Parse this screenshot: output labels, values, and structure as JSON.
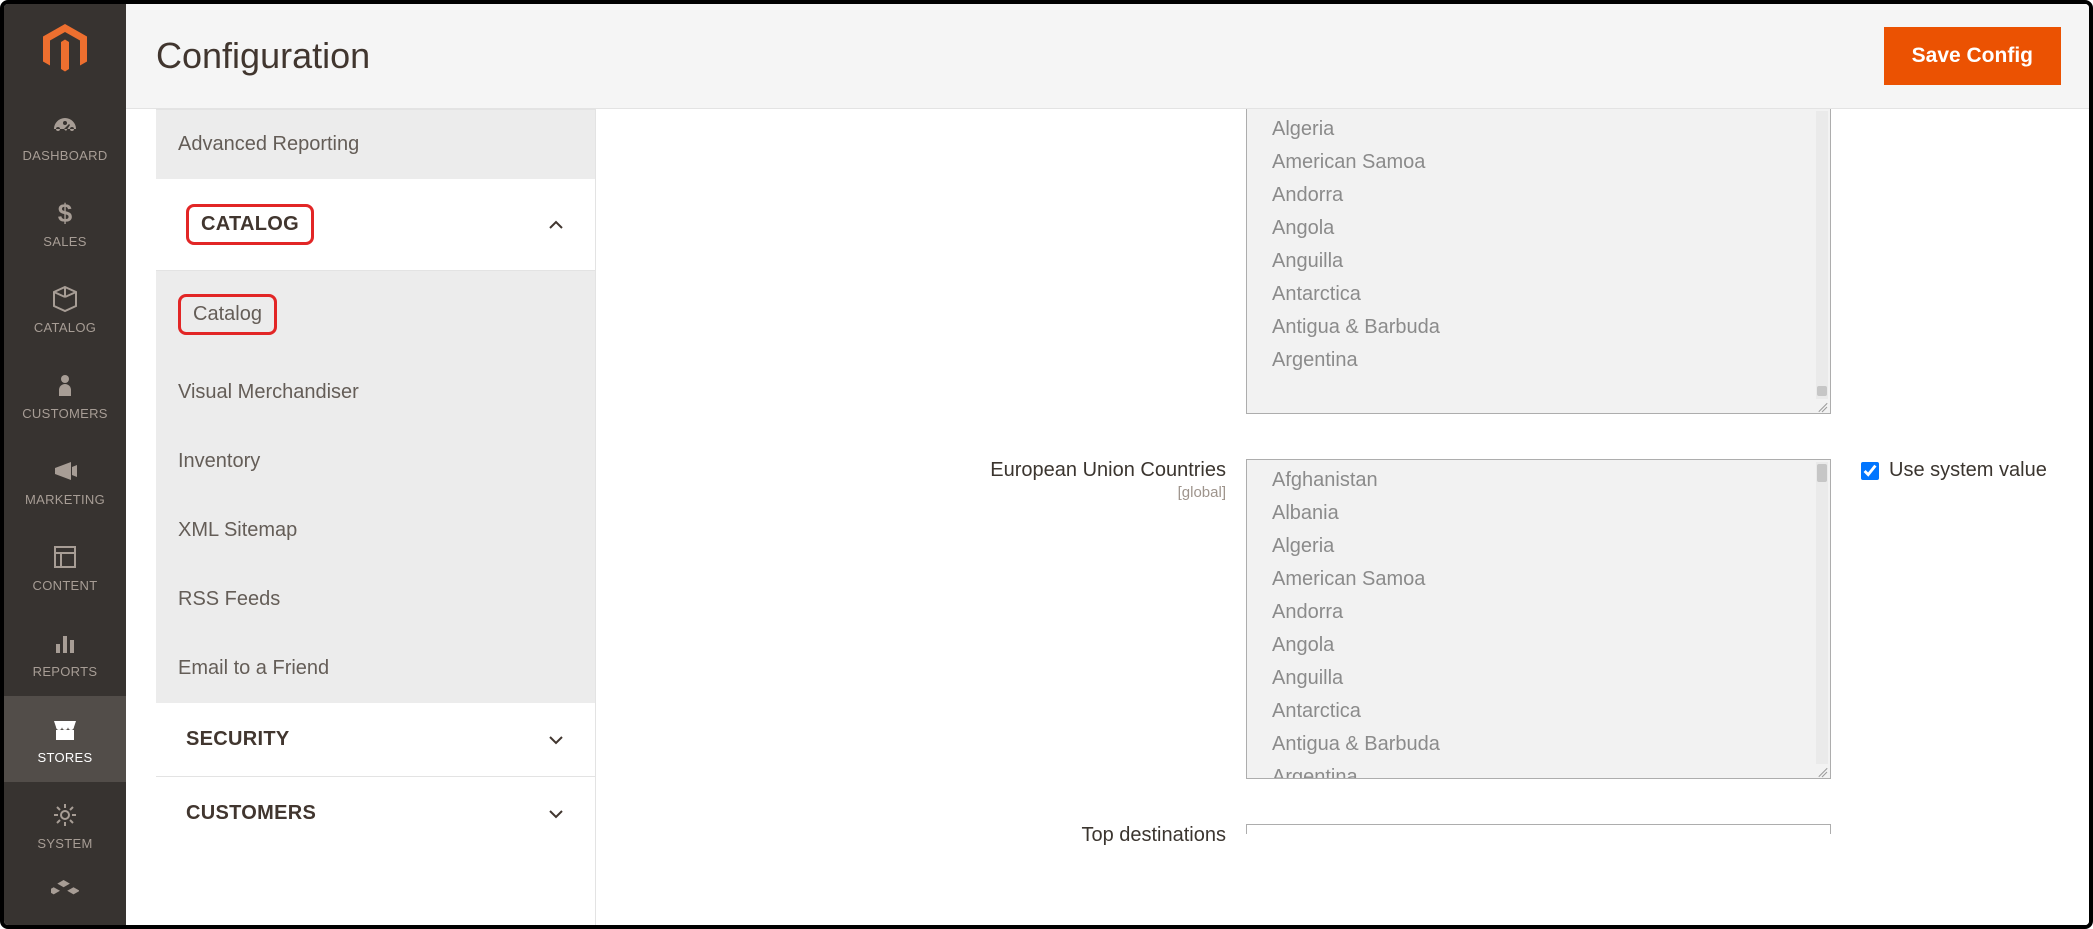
{
  "page": {
    "title": "Configuration",
    "save_button": "Save Config"
  },
  "leftnav": {
    "items": [
      {
        "key": "dashboard",
        "label": "DASHBOARD"
      },
      {
        "key": "sales",
        "label": "SALES"
      },
      {
        "key": "catalog",
        "label": "CATALOG"
      },
      {
        "key": "customers",
        "label": "CUSTOMERS"
      },
      {
        "key": "marketing",
        "label": "MARKETING"
      },
      {
        "key": "content",
        "label": "CONTENT"
      },
      {
        "key": "reports",
        "label": "REPORTS"
      },
      {
        "key": "stores",
        "label": "STORES"
      },
      {
        "key": "system",
        "label": "SYSTEM"
      },
      {
        "key": "partners",
        "label": ""
      }
    ]
  },
  "config_sidebar": {
    "advanced_reporting": "Advanced Reporting",
    "catalog_section": "CATALOG",
    "catalog_sub": "Catalog",
    "visual_merchandiser": "Visual Merchandiser",
    "inventory": "Inventory",
    "xml_sitemap": "XML Sitemap",
    "rss_feeds": "RSS Feeds",
    "email_friend": "Email to a Friend",
    "security_section": "SECURITY",
    "customers_section": "CUSTOMERS"
  },
  "fields": {
    "eu_countries": {
      "label": "European Union Countries",
      "scope": "[global]",
      "use_system_label": "Use system value",
      "use_system_checked": true
    },
    "top_destinations": {
      "label": "Top destinations"
    },
    "country_options_upper": [
      "Algeria",
      "American Samoa",
      "Andorra",
      "Angola",
      "Anguilla",
      "Antarctica",
      "Antigua & Barbuda",
      "Argentina"
    ],
    "country_options_full": [
      "Afghanistan",
      "Albania",
      "Algeria",
      "American Samoa",
      "Andorra",
      "Angola",
      "Anguilla",
      "Antarctica",
      "Antigua & Barbuda",
      "Argentina"
    ]
  }
}
